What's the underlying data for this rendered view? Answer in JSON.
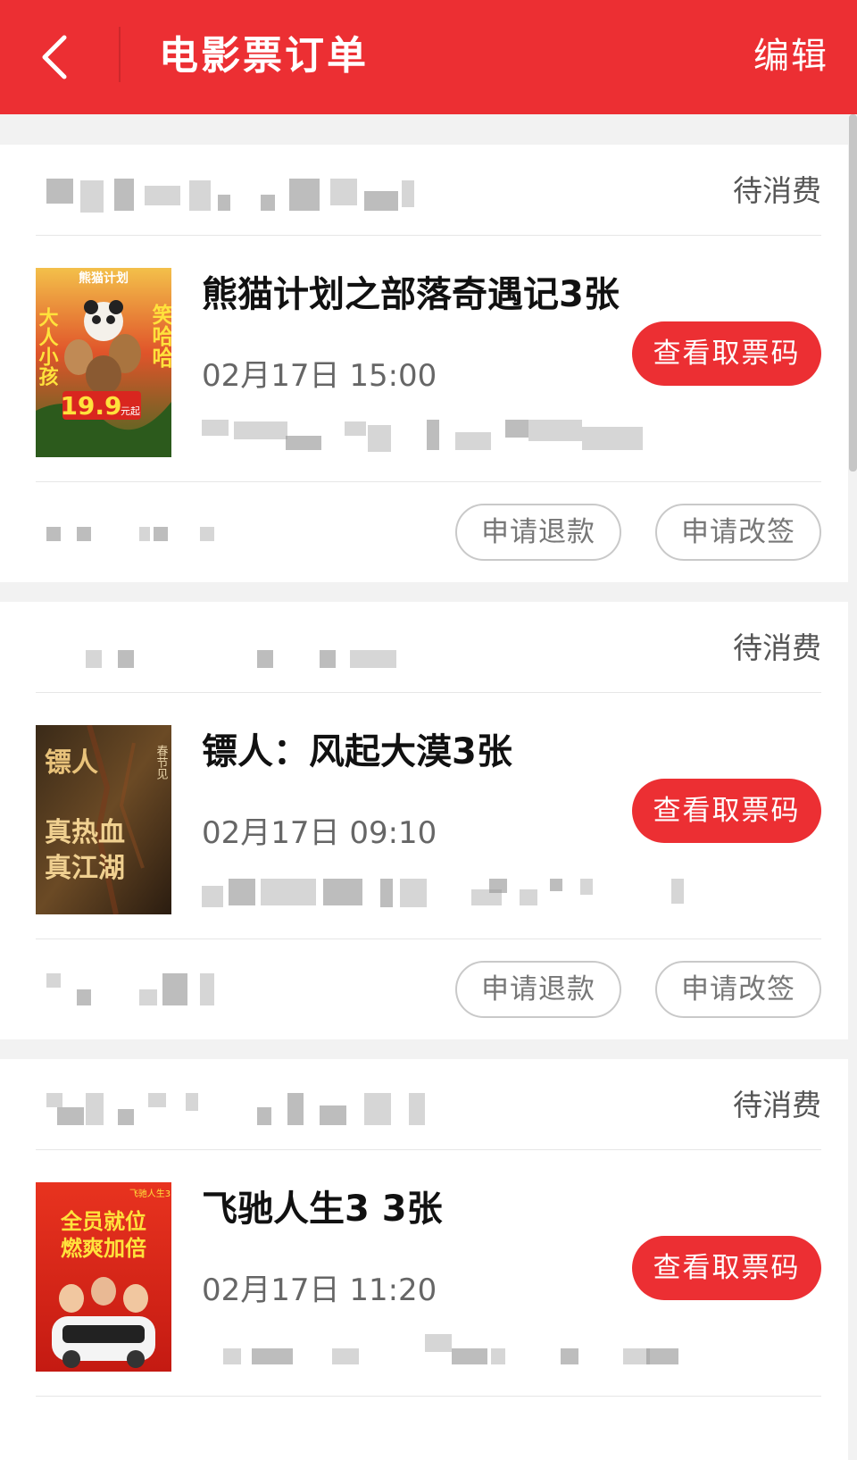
{
  "header": {
    "title": "电影票订单",
    "edit_label": "编辑",
    "background": "#ec2f33"
  },
  "orders": [
    {
      "status": "待消费",
      "movie_title": "熊猫计划之部落奇遇记3张",
      "showtime": "02月17日 15:00",
      "code_button": "查看取票码",
      "refund_button": "申请退款",
      "change_button": "申请改签",
      "poster": {
        "top_text": "熊猫计划",
        "left_text": "大人小孩",
        "right_text": "笑哈哈",
        "price_badge": "19.9",
        "price_suffix": "元起"
      }
    },
    {
      "status": "待消费",
      "movie_title": "镖人：风起大漠3张",
      "showtime": "02月17日 09:10",
      "code_button": "查看取票码",
      "refund_button": "申请退款",
      "change_button": "申请改签",
      "poster": {
        "corner_text": "春节见",
        "line1": "镖人",
        "line2": "真热血",
        "line3": "真江湖"
      }
    },
    {
      "status": "待消费",
      "movie_title": "飞驰人生3 3张",
      "showtime": "02月17日 11:20",
      "code_button": "查看取票码",
      "poster": {
        "corner_text": "飞驰人生3",
        "line1": "全员就位",
        "line2": "燃爽加倍"
      }
    }
  ],
  "icons": {
    "back": "chevron-left-icon"
  }
}
